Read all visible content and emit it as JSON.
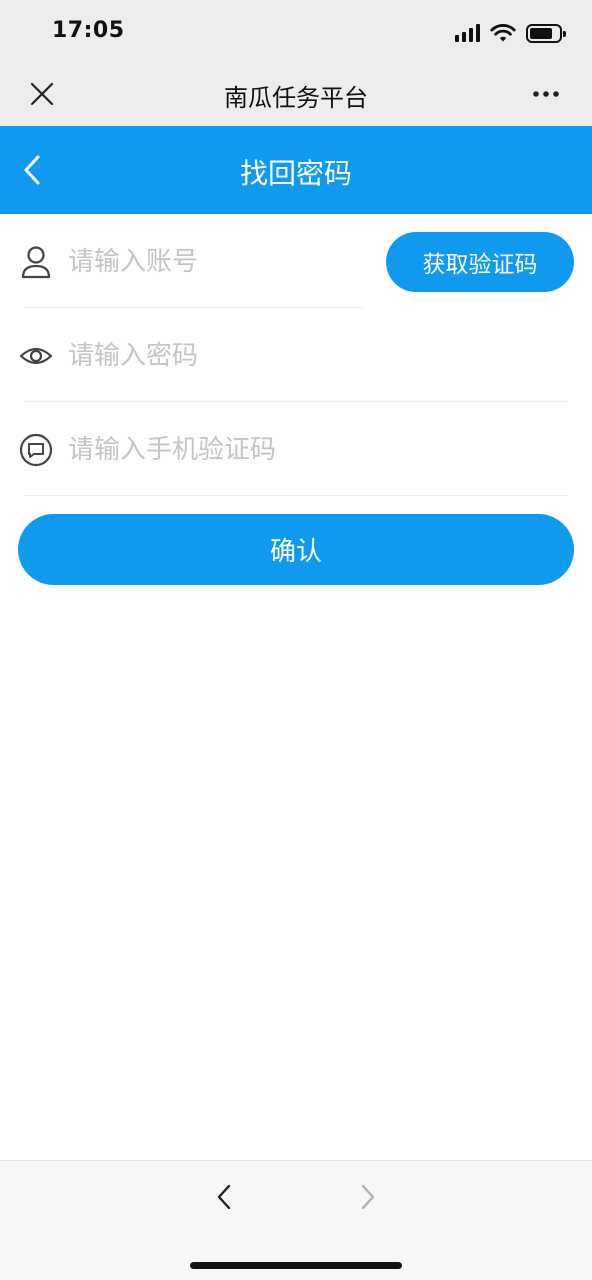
{
  "status_bar": {
    "time": "17:05",
    "icons": [
      "signal-icon",
      "wifi-icon",
      "battery-icon"
    ],
    "battery_level": 0.8
  },
  "webview": {
    "title": "南瓜任务平台",
    "close_icon": "close-icon",
    "more_icon": "more-icon"
  },
  "header": {
    "title": "找回密码",
    "back_icon": "chevron-left-icon",
    "background": "#0f9af0"
  },
  "form": {
    "account": {
      "placeholder": "请输入账号",
      "value": "",
      "icon": "user-icon"
    },
    "password": {
      "placeholder": "请输入密码",
      "value": "",
      "icon": "eye-icon"
    },
    "sms_code": {
      "placeholder": "请输入手机验证码",
      "value": "",
      "icon": "message-icon"
    },
    "get_code_label": "获取验证码",
    "confirm_label": "确认"
  },
  "bottom_toolbar": {
    "back_icon": "chevron-left-icon",
    "forward_icon": "chevron-right-icon"
  },
  "colors": {
    "accent": "#0f9af0",
    "chrome": "#ededed",
    "placeholder": "#c4c4c4"
  }
}
